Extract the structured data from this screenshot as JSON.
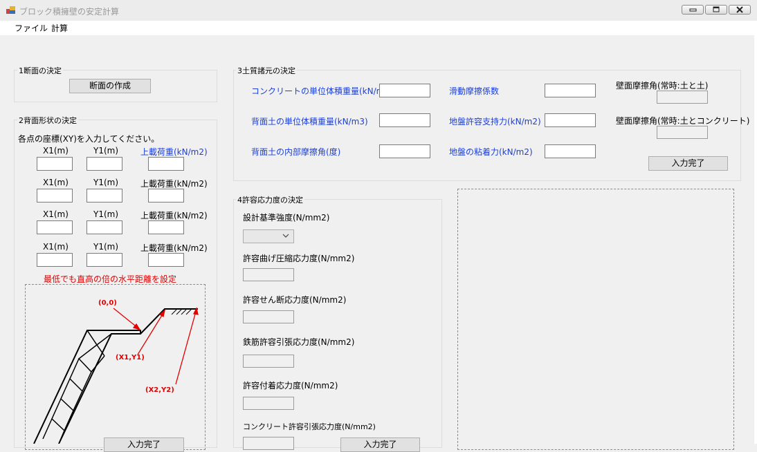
{
  "window": {
    "title": "ブロック積擁壁の安定計算",
    "buttons": [
      "minimize-icon",
      "maximize-icon",
      "close-icon"
    ]
  },
  "menu": {
    "file": "ファイル",
    "calc": "計算"
  },
  "section1": {
    "legend": "1断面の決定",
    "create_button": "断面の作成"
  },
  "section2": {
    "legend": "2背面形状の決定",
    "instruction": "各点の座標(XY)を入力してください。",
    "rows": [
      {
        "x": "X1(m)",
        "y": "Y1(m)",
        "load": "上載荷重(kN/m2)"
      },
      {
        "x": "X1(m)",
        "y": "Y1(m)",
        "load": "上載荷重(kN/m2)"
      },
      {
        "x": "X1(m)",
        "y": "Y1(m)",
        "load": "上載荷重(kN/m2)"
      },
      {
        "x": "X1(m)",
        "y": "Y1(m)",
        "load": "上載荷重(kN/m2)"
      }
    ],
    "note": "最低でも直高の倍の水平距離を設定",
    "diagram": {
      "p0": "(0,0)",
      "p1": "(X1,Y1)",
      "p2": "(X2,Y2)"
    },
    "done_button": "入力完了"
  },
  "section3": {
    "legend": "3土質諸元の決定",
    "fields": {
      "concrete_weight": "コンクリートの単位体積重量(kN/m3)",
      "backfill_weight": "背面土の単位体積重量(kN/m3)",
      "friction_angle": "背面土の内部摩擦角(度)",
      "slide_coef": "滑動摩擦係数",
      "bearing": "地盤許容支持力(kN/m2)",
      "cohesion": "地盤の粘着力(kN/m2)",
      "wall_fric_soil": "壁面摩擦角(常時:土と土)",
      "wall_fric_conc": "壁面摩擦角(常時:土とコンクリート)"
    },
    "done_button": "入力完了"
  },
  "section4": {
    "legend": "4許容応力度の決定",
    "design_strength": "設計基準強度(N/mm2)",
    "bending": "許容曲げ圧縮応力度(N/mm2)",
    "shear": "許容せん断応力度(N/mm2)",
    "rebar": "鉄筋許容引張応力度(N/mm2)",
    "bond": "許容付着応力度(N/mm2)",
    "tension": "コンクリート許容引張応力度(N/mm2)",
    "done_button": "入力完了"
  }
}
